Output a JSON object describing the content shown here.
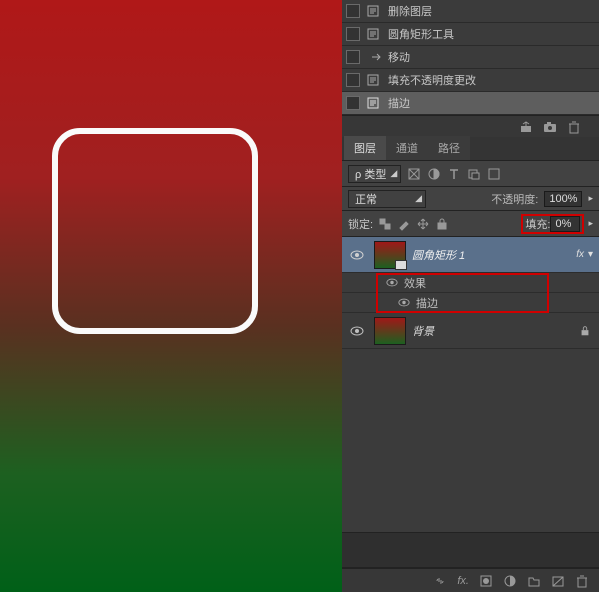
{
  "history": [
    {
      "label": "删除图层",
      "icon": "doc"
    },
    {
      "label": "圆角矩形工具",
      "icon": "doc"
    },
    {
      "label": "移动",
      "icon": "arrow",
      "indent": true
    },
    {
      "label": "填充不透明度更改",
      "icon": "doc"
    },
    {
      "label": "描边",
      "icon": "doc",
      "selected": true
    }
  ],
  "tabs": [
    {
      "label": "图层",
      "active": true
    },
    {
      "label": "通道",
      "active": false
    },
    {
      "label": "路径",
      "active": false
    }
  ],
  "type_dropdown": "ρ 类型",
  "blend_mode": "正常",
  "opacity_label": "不透明度:",
  "opacity_value": "100%",
  "lock_label": "锁定:",
  "fill_label": "填充:",
  "fill_value": "0%",
  "layers": {
    "shape": {
      "name": "圆角矩形 1",
      "fx": "fx"
    },
    "effects_label": "效果",
    "stroke_label": "描边",
    "background": {
      "name": "背景"
    }
  },
  "bottom_fx": "fx."
}
